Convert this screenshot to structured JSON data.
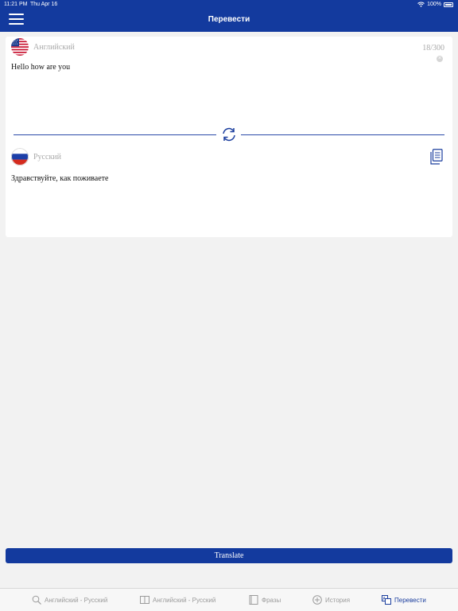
{
  "status_bar": {
    "time": "11:21 PM",
    "date": "Thu Apr 16",
    "battery": "100%"
  },
  "header": {
    "title": "Перевести"
  },
  "source": {
    "language": "Английский",
    "counter": "18/300",
    "text": "Hello how are you"
  },
  "target": {
    "language": "Русский",
    "text": "Здравствуйте, как поживаете"
  },
  "translate_button": {
    "label": "Translate"
  },
  "tabs": [
    {
      "label": "Английский - Русский",
      "icon": "search-icon"
    },
    {
      "label": "Английский - Русский",
      "icon": "book-icon"
    },
    {
      "label": "Фразы",
      "icon": "phrasebook-icon"
    },
    {
      "label": "История",
      "icon": "history-icon"
    },
    {
      "label": "Перевести",
      "icon": "translate-icon",
      "active": true
    }
  ],
  "colors": {
    "brand": "#133a9e",
    "background": "#f2f2f2",
    "muted_text": "#a9a9a9"
  }
}
